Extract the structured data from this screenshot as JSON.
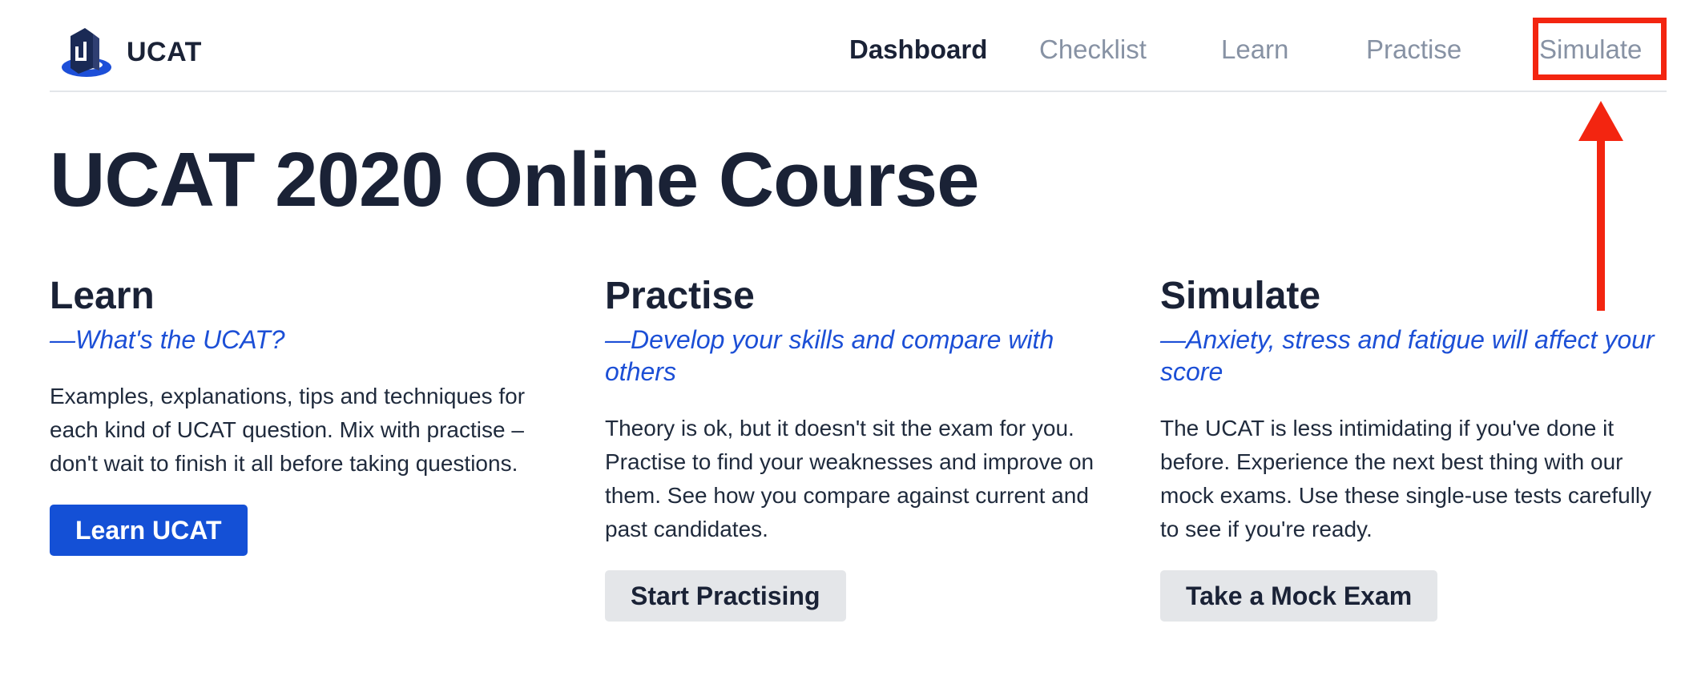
{
  "brand": {
    "name": "UCAT",
    "icon": "ucat-logo-icon",
    "logo_color": "#1d4fd8"
  },
  "nav": [
    {
      "label": "Dashboard",
      "active": true
    },
    {
      "label": "Checklist",
      "active": false
    },
    {
      "label": "Learn",
      "active": false
    },
    {
      "label": "Practise",
      "active": false
    },
    {
      "label": "Simulate",
      "active": false
    }
  ],
  "page": {
    "title": "UCAT 2020 Online Course"
  },
  "sections": [
    {
      "heading": "Learn",
      "subheading": "—What's the UCAT?",
      "body": "Examples, explanations, tips and techniques for each kind of UCAT question. Mix with practise – don't wait to finish it all before taking questions.",
      "button": "Learn UCAT",
      "button_style": "primary"
    },
    {
      "heading": "Practise",
      "subheading": "—Develop your skills and compare with others",
      "body": "Theory is ok, but it doesn't sit the exam for you. Practise to find your weaknesses and improve on them. See how you compare against current and past candidates.",
      "button": "Start Practising",
      "button_style": "secondary"
    },
    {
      "heading": "Simulate",
      "subheading": "—Anxiety, stress and fatigue will affect your score",
      "body": "The UCAT is less intimidating if you've done it before. Experience the next best thing with our mock exams. Use these single-use tests carefully to see if you're ready.",
      "button": "Take a Mock Exam",
      "button_style": "secondary"
    }
  ],
  "annotation": {
    "target": "Simulate",
    "color": "#f32510",
    "icon": "arrow-up-icon"
  },
  "colors": {
    "text_dark": "#1a2236",
    "nav_inactive": "#8792a4",
    "accent_blue": "#1450d6",
    "subheading_blue": "#1c4fd6",
    "secondary_button": "#e4e6e9"
  }
}
